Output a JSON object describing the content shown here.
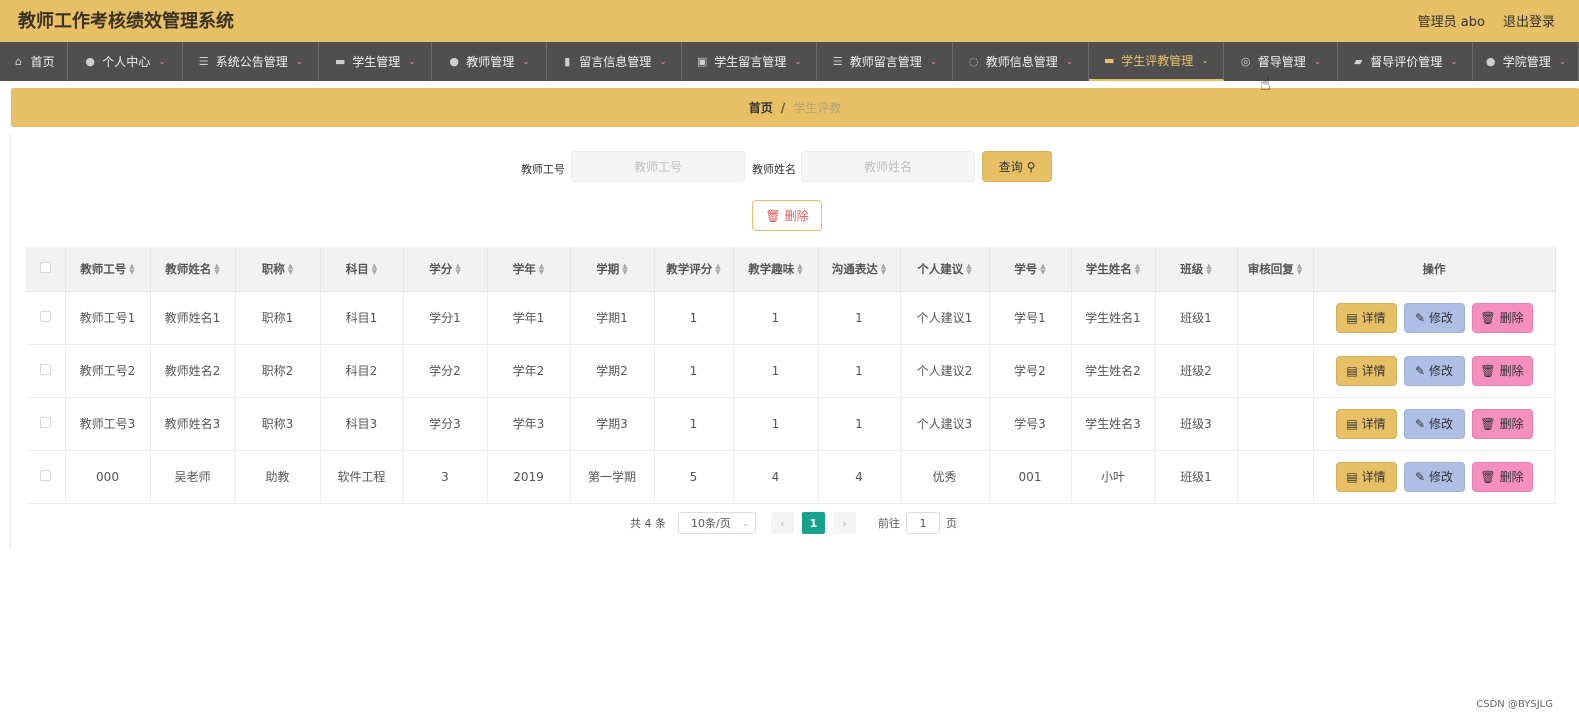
{
  "header": {
    "title": "教师工作考核绩效管理系统",
    "user": "管理员 abo",
    "logout": "退出登录"
  },
  "nav": [
    {
      "label": "首页",
      "icon": "⌂",
      "icon_name": "home-icon",
      "chevron": false
    },
    {
      "label": "个人中心",
      "icon": "●",
      "icon_name": "user-icon",
      "chevron": true
    },
    {
      "label": "系统公告管理",
      "icon": "☰",
      "icon_name": "sliders-icon",
      "chevron": true
    },
    {
      "label": "学生管理",
      "icon": "▬",
      "icon_name": "message-icon",
      "chevron": true
    },
    {
      "label": "教师管理",
      "icon": "●",
      "icon_name": "location-icon",
      "chevron": true
    },
    {
      "label": "留言信息管理",
      "icon": "▮",
      "icon_name": "chart-icon",
      "chevron": true
    },
    {
      "label": "学生留言管理",
      "icon": "▣",
      "icon_name": "clipboard-icon",
      "chevron": true
    },
    {
      "label": "教师留言管理",
      "icon": "☰",
      "icon_name": "list-icon",
      "chevron": true
    },
    {
      "label": "教师信息管理",
      "icon": "◌",
      "icon_name": "loading-icon",
      "chevron": true
    },
    {
      "label": "学生评教管理",
      "icon": "▬",
      "icon_name": "monitor-icon",
      "chevron": true,
      "active": true
    },
    {
      "label": "督导管理",
      "icon": "◎",
      "icon_name": "target-icon",
      "chevron": true
    },
    {
      "label": "督导评价管理",
      "icon": "▰",
      "icon_name": "bank-icon",
      "chevron": true
    },
    {
      "label": "学院管理",
      "icon": "●",
      "icon_name": "user-icon",
      "chevron": true
    }
  ],
  "breadcrumb": {
    "home": "首页",
    "sep": "/",
    "current": "学生评教"
  },
  "search": {
    "teacher_no_label": "教师工号",
    "teacher_no_placeholder": "教师工号",
    "teacher_name_label": "教师姓名",
    "teacher_name_placeholder": "教师姓名",
    "query_label": "查询",
    "delete_label": "删除"
  },
  "table": {
    "columns": [
      "教师工号",
      "教师姓名",
      "职称",
      "科目",
      "学分",
      "学年",
      "学期",
      "教学评分",
      "教学趣味",
      "沟通表达",
      "个人建议",
      "学号",
      "学生姓名",
      "班级",
      "审核回复",
      "操作"
    ],
    "rows": [
      [
        "教师工号1",
        "教师姓名1",
        "职称1",
        "科目1",
        "学分1",
        "学年1",
        "学期1",
        "1",
        "1",
        "1",
        "个人建议1",
        "学号1",
        "学生姓名1",
        "班级1",
        ""
      ],
      [
        "教师工号2",
        "教师姓名2",
        "职称2",
        "科目2",
        "学分2",
        "学年2",
        "学期2",
        "1",
        "1",
        "1",
        "个人建议2",
        "学号2",
        "学生姓名2",
        "班级2",
        ""
      ],
      [
        "教师工号3",
        "教师姓名3",
        "职称3",
        "科目3",
        "学分3",
        "学年3",
        "学期3",
        "1",
        "1",
        "1",
        "个人建议3",
        "学号3",
        "学生姓名3",
        "班级3",
        ""
      ],
      [
        "000",
        "吴老师",
        "助教",
        "软件工程",
        "3",
        "2019",
        "第一学期",
        "5",
        "4",
        "4",
        "优秀",
        "001",
        "小叶",
        "班级1",
        ""
      ]
    ],
    "actions": {
      "detail": "详情",
      "edit": "修改",
      "delete": "删除"
    }
  },
  "pagination": {
    "total": "共 4 条",
    "page_size": "10条/页",
    "current_page": "1",
    "goto_label": "前往",
    "goto_value": "1",
    "page_unit": "页"
  },
  "watermark": "CSDN @BYSJLG",
  "colors": {
    "accent": "#e7c066",
    "nav_bg": "#4f4f4f",
    "pager_active": "#17a28e",
    "edit": "#aebfe6",
    "delete": "#f48fbf"
  }
}
